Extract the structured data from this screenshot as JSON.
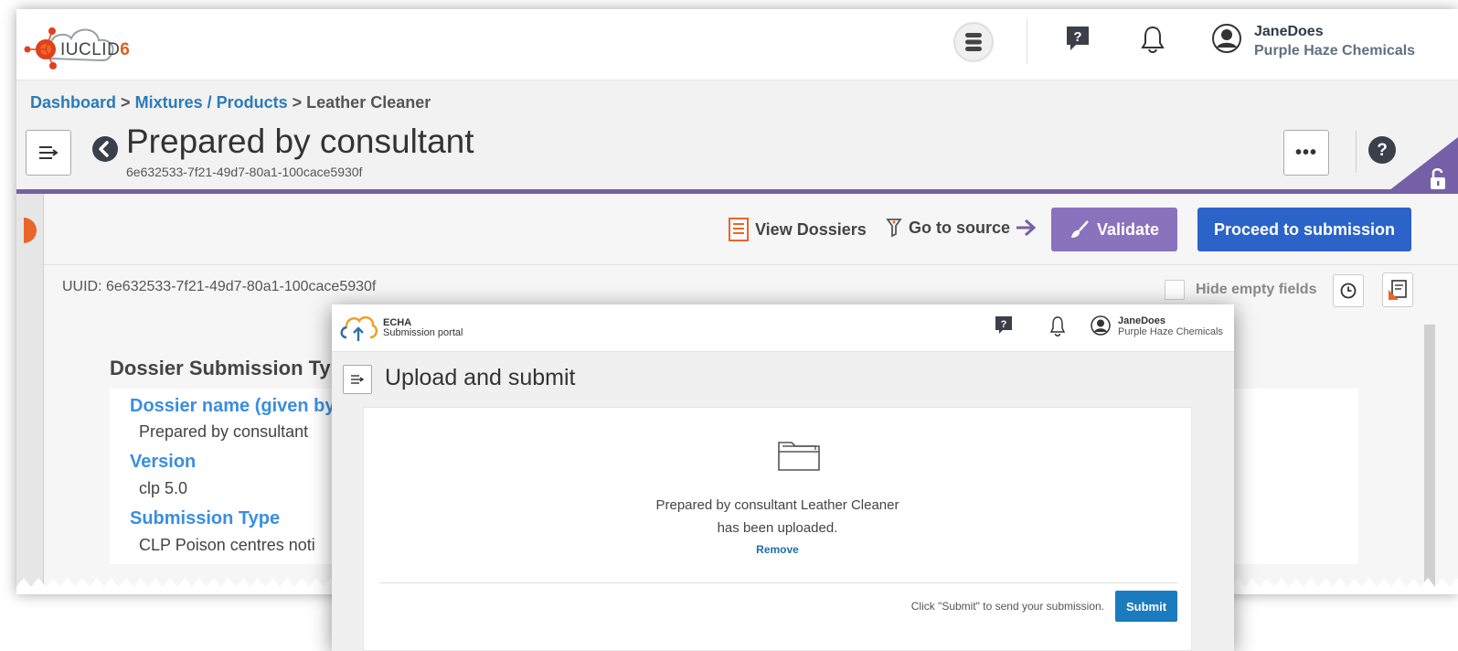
{
  "iuclid": {
    "logo": {
      "text_main": "IUCLID",
      "text_num": "6"
    },
    "user": {
      "name": "JaneDoes",
      "org": "Purple Haze Chemicals"
    },
    "breadcrumb": {
      "dashboard": "Dashboard",
      "sep1": ">",
      "mixtures": "Mixtures / Products",
      "sep2": ">",
      "current": "Leather Cleaner"
    },
    "document": {
      "title": "Prepared by consultant",
      "uuid": "6e632533-7f21-49d7-80a1-100cace5930f"
    },
    "more_label": "•••",
    "actions": {
      "view_dossiers": "View Dossiers",
      "go_to_source": "Go to source",
      "validate": "Validate",
      "proceed": "Proceed to submission"
    },
    "uuid_line": "UUID: 6e632533-7f21-49d7-80a1-100cace5930f",
    "hide_empty_fields": "Hide empty fields",
    "section_title": "Dossier Submission Ty",
    "fields": [
      {
        "label": "Dossier name (given by",
        "value": "Prepared by consultant"
      },
      {
        "label": "Version",
        "value": "clp 5.0"
      },
      {
        "label": "Submission Type",
        "value": "CLP Poison centres noti"
      }
    ],
    "colors": {
      "accent_purple": "#7560a8",
      "validate": "#8a72bd",
      "proceed": "#2b63c9",
      "link": "#2b7bb9",
      "field_label": "#3a8ee0"
    }
  },
  "echa": {
    "brand_line1": "ECHA",
    "brand_line2": "Submission portal",
    "user": {
      "name": "JaneDoes",
      "org": "Purple Haze Chemicals"
    },
    "page_title": "Upload and submit",
    "upload_message_line1": "Prepared by consultant Leather Cleaner",
    "upload_message_line2": "has been uploaded.",
    "remove_label": "Remove",
    "submit_hint": "Click \"Submit\" to send your submission.",
    "submit_label": "Submit",
    "colors": {
      "submit": "#1a7bbf",
      "link": "#1f6fa8"
    }
  },
  "icons": [
    "database-icon",
    "help-icon",
    "bell-icon",
    "user-avatar-icon",
    "menu-icon",
    "back-icon",
    "lock-icon",
    "dossier-list-icon",
    "source-icon",
    "arrow-right-icon",
    "brush-icon",
    "history-icon",
    "notes-icon",
    "cloud-upload-logo",
    "folder-icon"
  ]
}
